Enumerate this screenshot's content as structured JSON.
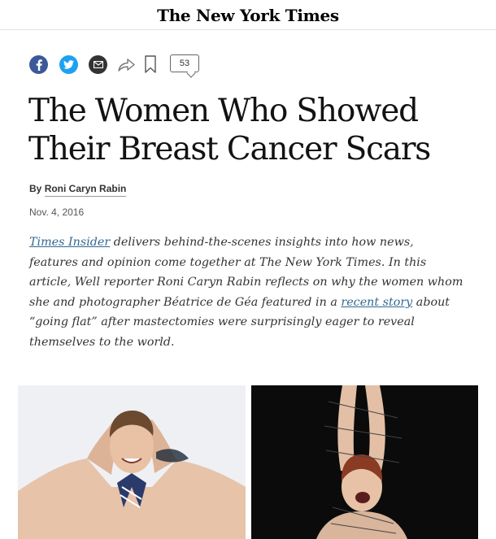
{
  "masthead": {
    "logo_text": "The New York Times"
  },
  "share_bar": {
    "icons": [
      "facebook-icon",
      "twitter-icon",
      "email-icon",
      "share-icon",
      "bookmark-icon",
      "comment-icon"
    ],
    "comment_count": "53",
    "colors": {
      "facebook": "#3b5998",
      "twitter": "#1da1f2",
      "email": "#333333"
    }
  },
  "article": {
    "headline": "The Women Who Showed Their Breast Cancer Scars",
    "byline_prefix": "By",
    "author": "Roni Caryn Rabin",
    "date": "Nov. 4, 2016",
    "intro": {
      "link1": "Times Insider",
      "text1": " delivers behind-the-scenes insights into how news, features and opinion come together at The New York Times. In this article, Well reporter Roni Caryn Rabin reflects on why the women whom she and photographer Béatrice de Géa featured in a ",
      "link2": "recent story",
      "text2": " about “going flat” after mastectomies were surprisingly eager to reveal themselves to the world."
    },
    "link_color": "#326891"
  },
  "photos": [
    "photo-left",
    "photo-right"
  ]
}
